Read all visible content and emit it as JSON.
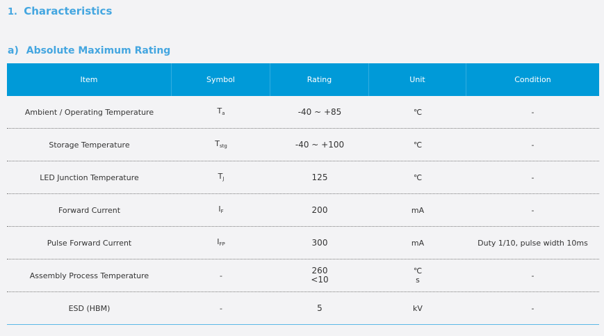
{
  "section": {
    "number": "1.",
    "title": "Characteristics"
  },
  "subsection": {
    "number": "a)",
    "title": "Absolute Maximum Rating"
  },
  "table": {
    "headers": [
      "Item",
      "Symbol",
      "Rating",
      "Unit",
      "Condition"
    ],
    "rows": [
      {
        "item": "Ambient / Operating Temperature",
        "symbol": "T",
        "symbol_sub": "a",
        "rating": "-40 ~ +85",
        "rating2": "",
        "unit": "℃",
        "unit2": "",
        "condition": "-"
      },
      {
        "item": "Storage Temperature",
        "symbol": "T",
        "symbol_sub": "stg",
        "rating": "-40 ~ +100",
        "rating2": "",
        "unit": "℃",
        "unit2": "",
        "condition": "-"
      },
      {
        "item": "LED Junction Temperature",
        "symbol": "T",
        "symbol_sub": "J",
        "rating": "125",
        "rating2": "",
        "unit": "℃",
        "unit2": "",
        "condition": "-"
      },
      {
        "item": "Forward Current",
        "symbol": "I",
        "symbol_sub": "F",
        "rating": "200",
        "rating2": "",
        "unit": "mA",
        "unit2": "",
        "condition": "-"
      },
      {
        "item": "Pulse Forward Current",
        "symbol": "I",
        "symbol_sub": "FP",
        "rating": "300",
        "rating2": "",
        "unit": "mA",
        "unit2": "",
        "condition": "Duty 1/10, pulse width 10ms"
      },
      {
        "item": "Assembly Process Temperature",
        "symbol": "-",
        "symbol_sub": "",
        "rating": "260",
        "rating2": "<10",
        "unit": "℃",
        "unit2": "s",
        "condition": "-"
      },
      {
        "item": "ESD (HBM)",
        "symbol": "-",
        "symbol_sub": "",
        "rating": "5",
        "rating2": "",
        "unit": "kV",
        "unit2": "",
        "condition": "-"
      }
    ]
  }
}
